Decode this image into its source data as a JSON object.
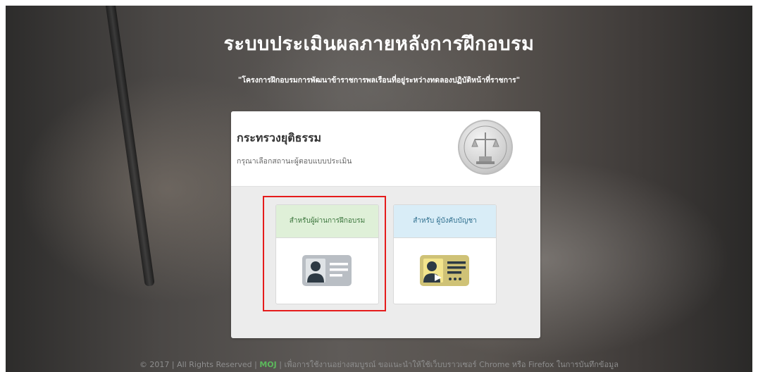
{
  "header": {
    "title": "ระบบประเมินผลภายหลังการฝึกอบรม",
    "subtitle": "\"โครงการฝึกอบรมการพัฒนาข้าราชการพลเรือนที่อยู่ระหว่างทดลองปฏิบัติหน้าที่ราชการ\""
  },
  "card": {
    "org_name": "กระทรวงยุติธรรม",
    "instruction": "กรุณาเลือกสถานะผู้ตอบแบบประเมิน",
    "seal_icon": "ministry-seal-icon",
    "options": [
      {
        "label": "สำหรับผู้ผ่านการฝึกอบรม",
        "icon": "id-card-icon",
        "accent": "#dff0d8",
        "selected": true
      },
      {
        "label": "สำหรับ ผู้บังคับบัญชา",
        "icon": "supervisor-card-icon",
        "accent": "#d9edf7",
        "selected": false
      }
    ]
  },
  "footer": {
    "copyright": "© 2017 | All Rights Reserved | ",
    "brand": "MOJ",
    "notice": " | เพื่อการใช้งานอย่างสมบูรณ์ ขอแนะนำให้ใช้เว็บบราวเซอร์ Chrome หรือ Firefox ในการบันทึกข้อมูล"
  },
  "colors": {
    "highlight": "#e51c1c",
    "brand_green": "#5cb85c"
  }
}
